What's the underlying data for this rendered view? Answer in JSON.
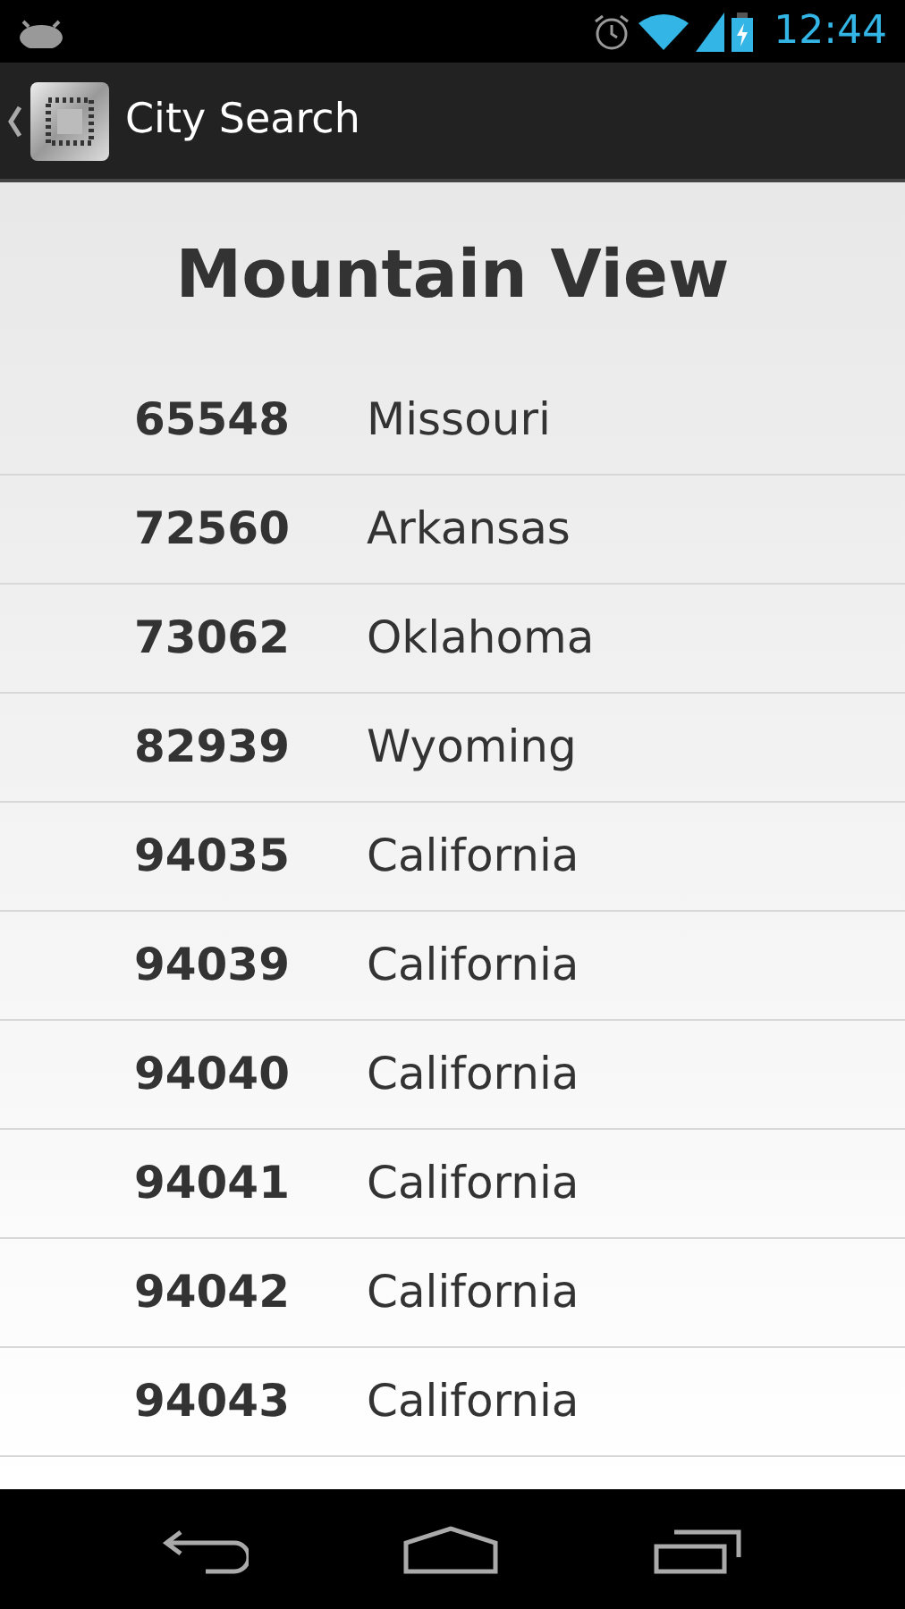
{
  "status_bar": {
    "time": "12:44"
  },
  "action_bar": {
    "title": "City Search"
  },
  "heading": "Mountain View",
  "rows": [
    {
      "zip": "65548",
      "state": "Missouri"
    },
    {
      "zip": "72560",
      "state": "Arkansas"
    },
    {
      "zip": "73062",
      "state": "Oklahoma"
    },
    {
      "zip": "82939",
      "state": "Wyoming"
    },
    {
      "zip": "94035",
      "state": "California"
    },
    {
      "zip": "94039",
      "state": "California"
    },
    {
      "zip": "94040",
      "state": "California"
    },
    {
      "zip": "94041",
      "state": "California"
    },
    {
      "zip": "94042",
      "state": "California"
    },
    {
      "zip": "94043",
      "state": "California"
    }
  ]
}
